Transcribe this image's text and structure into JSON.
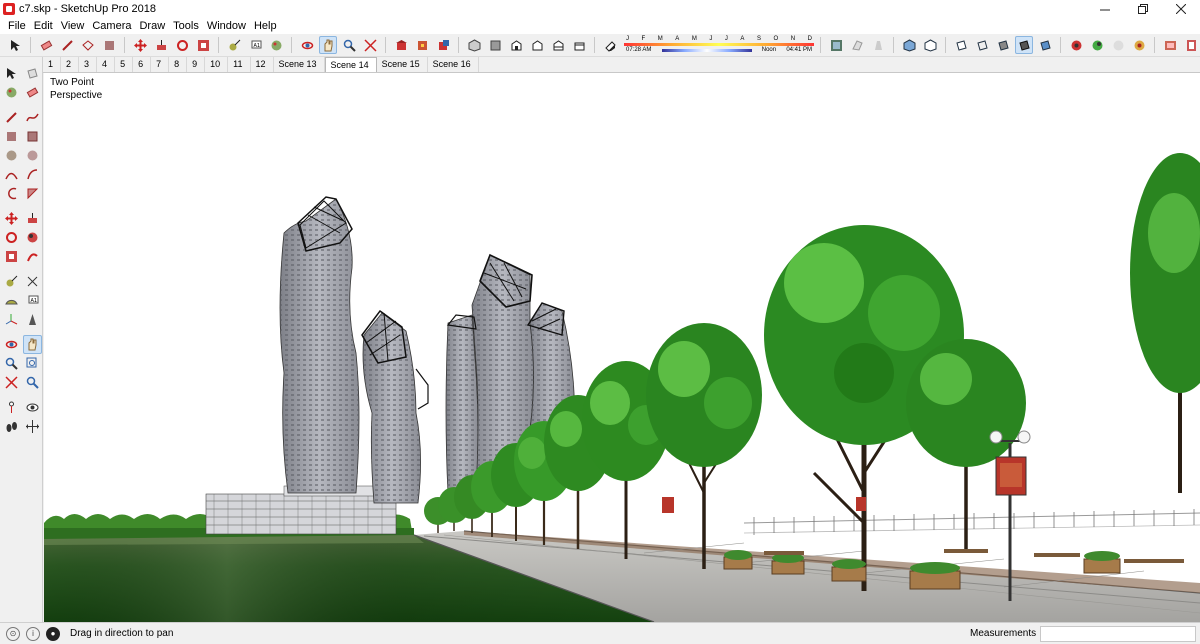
{
  "window": {
    "title": "c7.skp - SketchUp Pro 2018",
    "controls": [
      "minimize",
      "restore",
      "close"
    ]
  },
  "menu": [
    "File",
    "Edit",
    "View",
    "Camera",
    "Draw",
    "Tools",
    "Window",
    "Help"
  ],
  "toolbar": {
    "icons": [
      "select-icon",
      "eraser-icon",
      "pencil-icon",
      "shape-icon",
      "paint-icon",
      "move-icon",
      "rotate-icon",
      "push-pull-icon",
      "offset-icon",
      "follow-me-icon",
      "tape-icon",
      "text-icon",
      "axes-icon",
      "orbit-icon",
      "pan-icon",
      "zoom-icon",
      "zoom-extents-icon",
      "warehouse-icon",
      "extension-icon",
      "components-icon",
      "iso-icon",
      "top-icon",
      "front-icon",
      "right-icon",
      "back-icon",
      "left-icon",
      "shadow-toggle-icon"
    ],
    "shadow": {
      "months": [
        "J",
        "F",
        "M",
        "A",
        "M",
        "J",
        "J",
        "A",
        "S",
        "O",
        "N",
        "D"
      ],
      "time_start": "07:28 AM",
      "time_mid": "Noon",
      "time_end": "04:41 PM"
    }
  },
  "scenes": [
    {
      "label": "1"
    },
    {
      "label": "2"
    },
    {
      "label": "3"
    },
    {
      "label": "4"
    },
    {
      "label": "5"
    },
    {
      "label": "6"
    },
    {
      "label": "7"
    },
    {
      "label": "8"
    },
    {
      "label": "9"
    },
    {
      "label": "10"
    },
    {
      "label": "11"
    },
    {
      "label": "12"
    },
    {
      "label": "Scene 13"
    },
    {
      "label": "Scene 14",
      "active": true
    },
    {
      "label": "Scene 15"
    },
    {
      "label": "Scene 16"
    }
  ],
  "viewport": {
    "camera_label": "Two Point\nPerspective"
  },
  "status": {
    "message": "Drag in direction to pan",
    "measurements_label": "Measurements",
    "measurements_value": ""
  },
  "colors": {
    "accent": "#cfe3f7",
    "lawn": "#1f5e1c",
    "foliage": "#2f8a20",
    "sky": "#ffffff"
  }
}
